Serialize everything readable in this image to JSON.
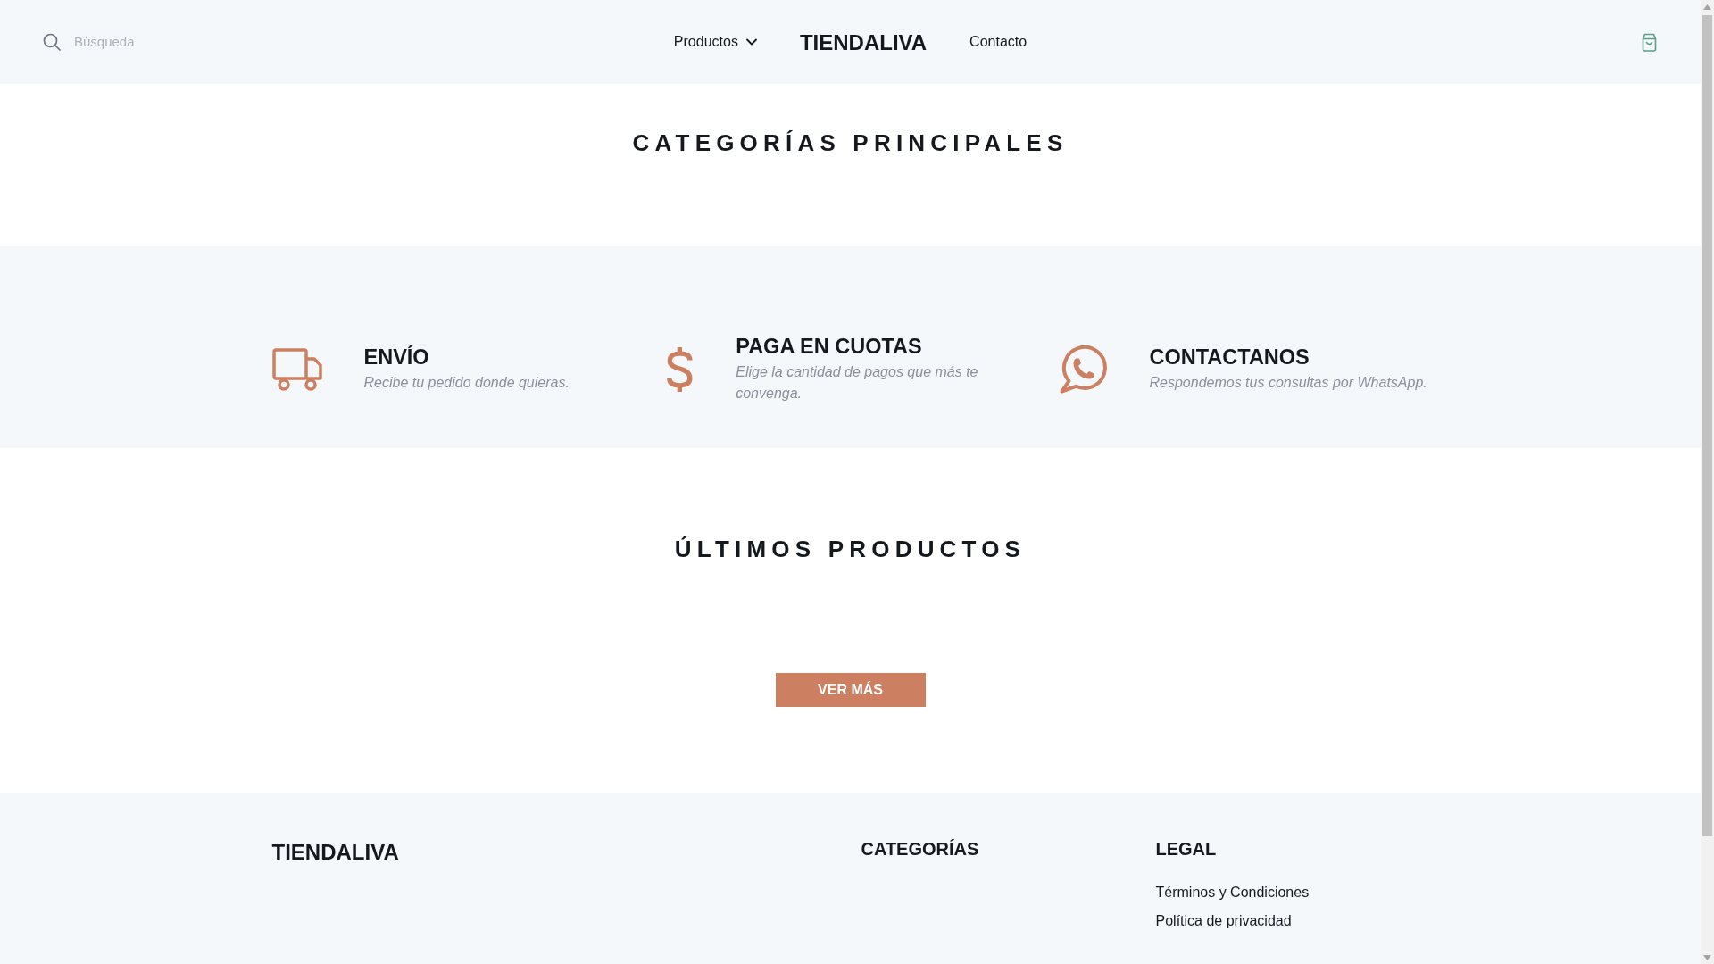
{
  "header": {
    "search": {
      "placeholder": "Búsqueda"
    },
    "nav": [
      {
        "label": "Productos",
        "kind": "dropdown"
      },
      {
        "label": "TIENDALIVA",
        "kind": "brand"
      },
      {
        "label": "Contacto",
        "kind": "link"
      }
    ]
  },
  "categories_section": {
    "title": "CATEGORÍAS PRINCIPALES"
  },
  "features": [
    {
      "kind": "delivery",
      "title": "ENVÍO",
      "text": "Recibe tu pedido donde quieras."
    },
    {
      "kind": "payment",
      "title": "PAGA EN CUOTAS",
      "text": "Elige la cantidad de pagos que más te convenga."
    },
    {
      "kind": "chat",
      "title": "CONTACTANOS",
      "text": "Respondemos tus consultas por WhatsApp."
    }
  ],
  "latest_section": {
    "title": "ÚLTIMOS PRODUCTOS",
    "button": "VER MÁS"
  },
  "footer": {
    "brand": "TIENDALIVA",
    "columns": [
      {
        "heading": "CATEGORÍAS"
      },
      {
        "heading": "LEGAL",
        "links": [
          "Términos y Condiciones",
          "Política de privacidad"
        ]
      }
    ]
  }
}
